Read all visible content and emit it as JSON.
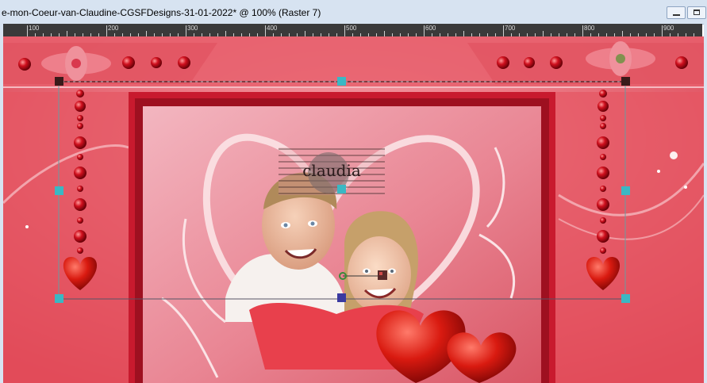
{
  "window": {
    "title": "e-mon-Coeur-van-Claudine-CGSFDesigns-31-01-2022* @ 100% (Raster 7)"
  },
  "ruler": {
    "labels": [
      "100",
      "200",
      "300",
      "400",
      "500",
      "600",
      "700",
      "800",
      "900"
    ]
  },
  "watermark": {
    "text": "claudia"
  },
  "colors": {
    "canvas_bg": "#e84a5a",
    "panel_pink": "#ee8a96",
    "frame_red": "#c81a2e",
    "handle_teal": "#3ab8c4",
    "ruler_bg": "#3a3a3a",
    "titlebar": "#d7e3f1"
  }
}
